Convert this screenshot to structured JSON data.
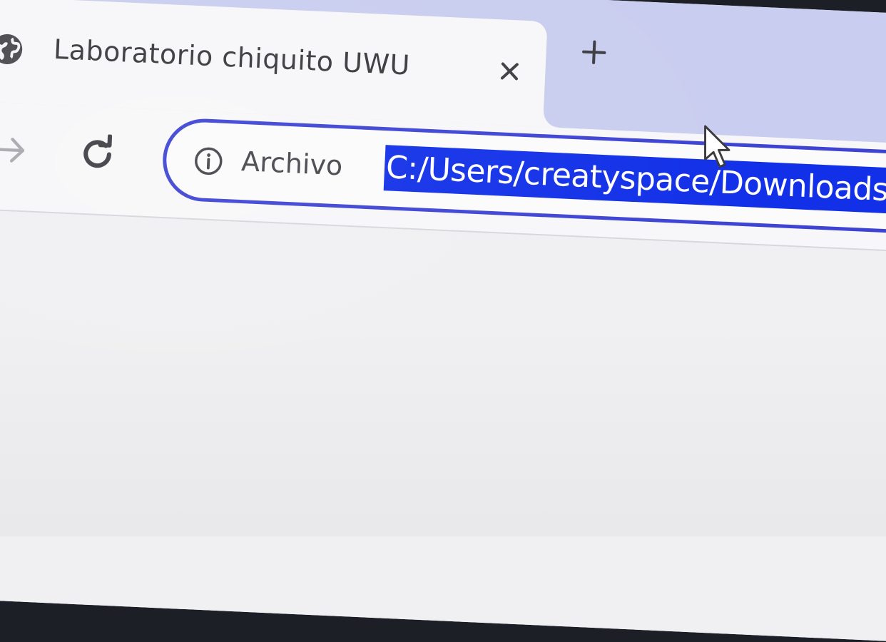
{
  "browser": {
    "tab": {
      "title": "Laboratorio chiquito UWU",
      "favicon": "globe-icon",
      "close_icon": "close-icon"
    },
    "new_tab_icon": "plus-icon",
    "toolbar": {
      "forward_icon": "arrow-right-icon",
      "reload_icon": "reload-icon"
    },
    "omnibox": {
      "security_icon": "info-icon",
      "scheme_label": "Archivo",
      "url": "C:/Users/creatyspace/Downloads/la"
    }
  },
  "colors": {
    "tab_strip": "#c9cdef",
    "omnibox_border": "#3d44d4",
    "selection": "#1230e8",
    "background": "#f0f0f2"
  }
}
